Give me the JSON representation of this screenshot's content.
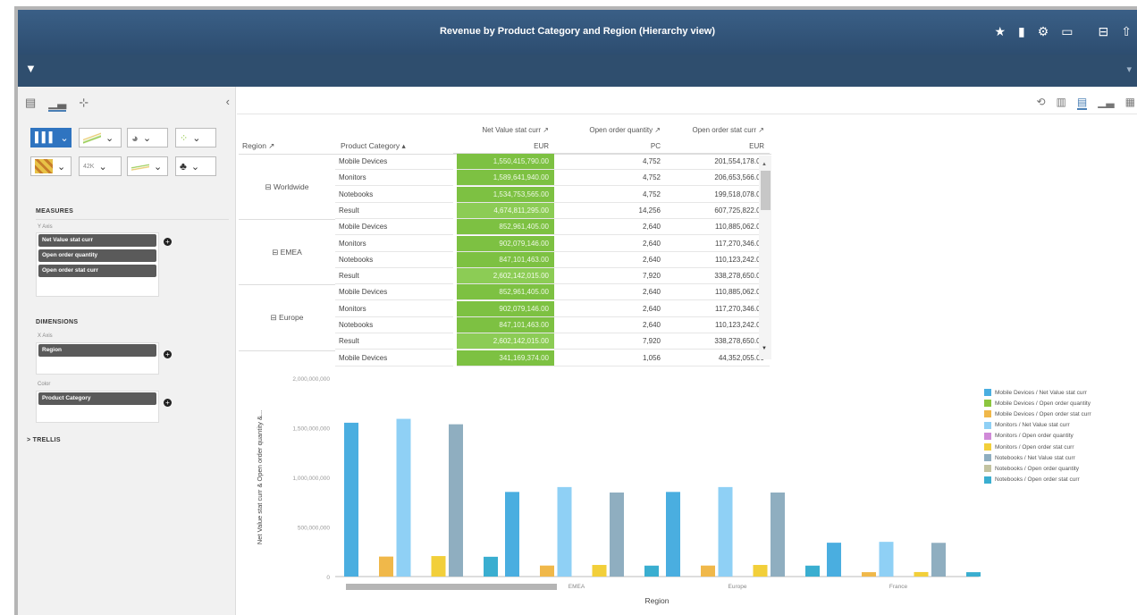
{
  "header": {
    "title": "Revenue by Product Category and Region (Hierarchy view)",
    "icons": [
      "star-icon",
      "bookmark-icon",
      "gear-icon",
      "window-icon",
      "sheet-icon",
      "share-icon"
    ]
  },
  "filterbar": {
    "left_icon": "filter-icon",
    "right_icon": "filter-small-icon"
  },
  "left_panel": {
    "tabs": [
      "table-icon",
      "chart-icon",
      "settings-icon"
    ],
    "sections": {
      "measures": "MEASURES",
      "dimensions": "DIMENSIONS",
      "trellis": "> TRELLIS"
    },
    "y_axis_label": "Y Axis",
    "x_axis_label": "X Axis",
    "color_label": "Color",
    "measures": [
      "Net Value stat curr",
      "Open order quantity",
      "Open order stat curr"
    ],
    "dimensions": [
      "Region"
    ],
    "color": [
      "Product Category"
    ],
    "chart_type_value": "42K"
  },
  "table": {
    "col_headers": [
      "Net Value stat curr",
      "Open order quantity",
      "Open order stat curr"
    ],
    "units": [
      "EUR",
      "PC",
      "EUR"
    ],
    "row_headers": [
      "Region",
      "Product Category"
    ],
    "regions": [
      {
        "name": "Worldwide",
        "rows": [
          [
            "Mobile Devices",
            "1,550,415,790.00",
            "4,752",
            "201,554,178.00"
          ],
          [
            "Monitors",
            "1,589,641,940.00",
            "4,752",
            "206,653,566.00"
          ],
          [
            "Notebooks",
            "1,534,753,565.00",
            "4,752",
            "199,518,078.00"
          ],
          [
            "Result",
            "4,674,811,295.00",
            "14,256",
            "607,725,822.00"
          ]
        ]
      },
      {
        "name": "EMEA",
        "rows": [
          [
            "Mobile Devices",
            "852,961,405.00",
            "2,640",
            "110,885,062.00"
          ],
          [
            "Monitors",
            "902,079,146.00",
            "2,640",
            "117,270,346.00"
          ],
          [
            "Notebooks",
            "847,101,463.00",
            "2,640",
            "110,123,242.00"
          ],
          [
            "Result",
            "2,602,142,015.00",
            "7,920",
            "338,278,650.00"
          ]
        ]
      },
      {
        "name": "Europe",
        "rows": [
          [
            "Mobile Devices",
            "852,961,405.00",
            "2,640",
            "110,885,062.00"
          ],
          [
            "Monitors",
            "902,079,146.00",
            "2,640",
            "117,270,346.00"
          ],
          [
            "Notebooks",
            "847,101,463.00",
            "2,640",
            "110,123,242.00"
          ],
          [
            "Result",
            "2,602,142,015.00",
            "7,920",
            "338,278,650.00"
          ]
        ]
      },
      {
        "name": "",
        "rows": [
          [
            "Mobile Devices",
            "341,169,374.00",
            "1,056",
            "44,352,055.00"
          ]
        ]
      }
    ]
  },
  "colors": {
    "accent": "#2f74c0",
    "green_cell": "#7dc142",
    "title_bar": "#34587c"
  },
  "chart_data": {
    "type": "bar",
    "categories": [
      "Worldwide",
      "EMEA",
      "Europe",
      "France"
    ],
    "xlabel": "Region",
    "ylabel": "Net Value stat curr & Open order quantity &...",
    "ylim": [
      0,
      2000000000
    ],
    "yticks": [
      "2,000,000,000",
      "1,500,000,000",
      "1,000,000,000",
      "500,000,000",
      "0"
    ],
    "series": [
      {
        "name": "Mobile Devices / Net Value stat curr",
        "color": "#4aaee0",
        "values": [
          1550415790,
          852961405,
          852961405,
          341169374
        ]
      },
      {
        "name": "Mobile Devices / Open order quantity",
        "color": "#8cc63f",
        "values": [
          4752,
          2640,
          2640,
          1056
        ]
      },
      {
        "name": "Mobile Devices / Open order stat curr",
        "color": "#f0b84a",
        "values": [
          201554178,
          110885062,
          110885062,
          44352055
        ]
      },
      {
        "name": "Monitors / Net Value stat curr",
        "color": "#8fd0f5",
        "values": [
          1589641940,
          902079146,
          902079146,
          350000000
        ]
      },
      {
        "name": "Monitors / Open order quantity",
        "color": "#d08ad8",
        "values": [
          4752,
          2640,
          2640,
          1056
        ]
      },
      {
        "name": "Monitors / Open order stat curr",
        "color": "#f2cf3a",
        "values": [
          206653566,
          117270346,
          117270346,
          45500000
        ]
      },
      {
        "name": "Notebooks / Net Value stat curr",
        "color": "#8faec0",
        "values": [
          1534753565,
          847101463,
          847101463,
          340000000
        ]
      },
      {
        "name": "Notebooks / Open order quantity",
        "color": "#c3c3a0",
        "values": [
          4752,
          2640,
          2640,
          1056
        ]
      },
      {
        "name": "Notebooks / Open order stat curr",
        "color": "#3aaed0",
        "values": [
          199518078,
          110123242,
          110123242,
          44200000
        ]
      }
    ],
    "legend_position": "right"
  }
}
